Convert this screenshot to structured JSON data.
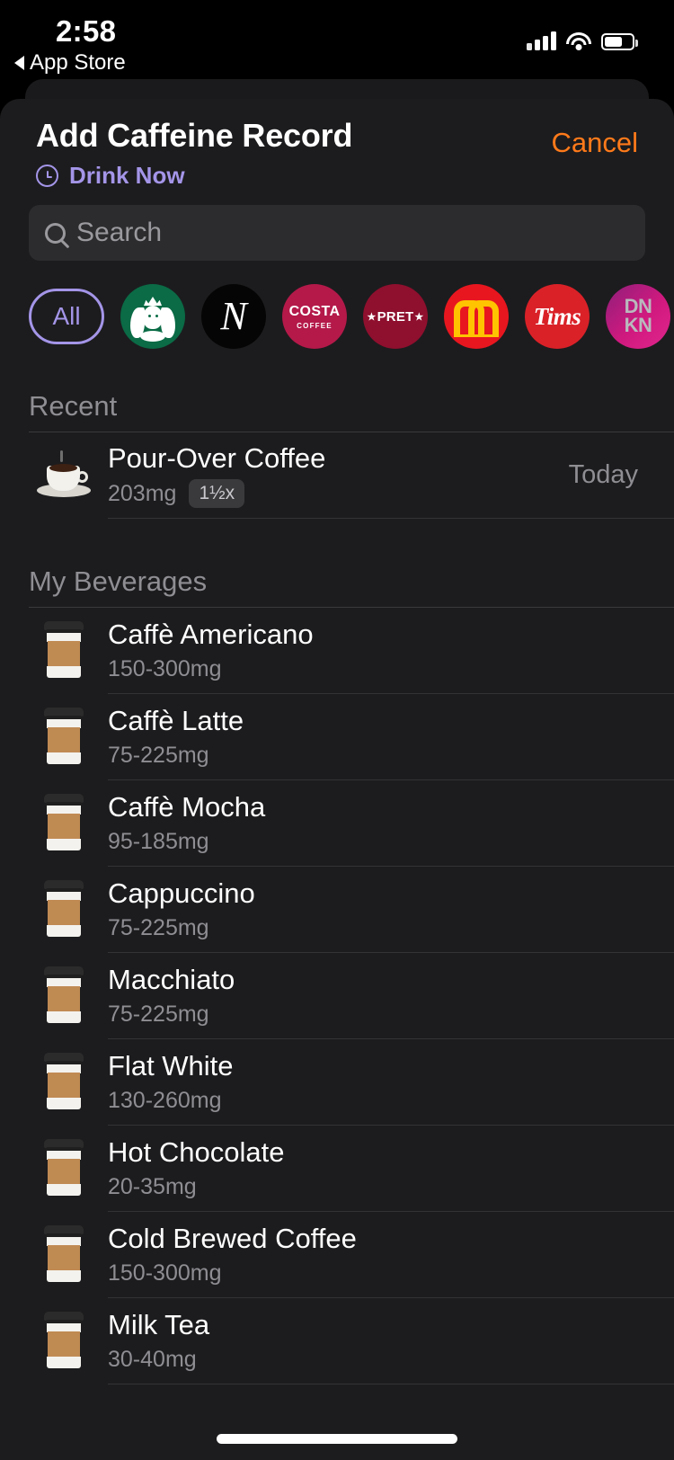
{
  "status_bar": {
    "time": "2:58",
    "back_label": "App Store",
    "icons": [
      "signal-bars-icon",
      "wifi-icon",
      "battery-icon"
    ]
  },
  "sheet": {
    "title": "Add Caffeine Record",
    "cancel_label": "Cancel",
    "drink_now_label": "Drink Now",
    "drink_now_icon": "clock-icon",
    "accent_purple": "#a495e8",
    "accent_orange": "#ff7a1a"
  },
  "search": {
    "placeholder": "Search",
    "value": "",
    "icon": "search-icon"
  },
  "brands": [
    {
      "id": "all",
      "label": "All",
      "selected": true,
      "color": "#a495e8"
    },
    {
      "id": "starbucks",
      "label": "Starbucks",
      "selected": false,
      "color": "#0a6b46"
    },
    {
      "id": "nespresso",
      "label": "Nespresso",
      "selected": false,
      "color": "#050505"
    },
    {
      "id": "costa",
      "label": "Costa Coffee",
      "selected": false,
      "color": "#b4194a"
    },
    {
      "id": "pret",
      "label": "Pret",
      "selected": false,
      "color": "#8f0f2e"
    },
    {
      "id": "mcdonalds",
      "label": "McDonald's",
      "selected": false,
      "color": "#e8161f"
    },
    {
      "id": "tims",
      "label": "Tims",
      "selected": false,
      "color": "#da2128"
    },
    {
      "id": "dunkin",
      "label": "Dunkin'",
      "selected": false,
      "color": "#c4187e"
    }
  ],
  "brand_text": {
    "costa_line1": "COSTA",
    "costa_line2": "COFFEE",
    "pret": "PRET",
    "tims": "Tims",
    "dunkin_line1": "DN",
    "dunkin_line2": "KN",
    "nespresso": "N"
  },
  "recent": {
    "header": "Recent",
    "items": [
      {
        "name": "Pour-Over Coffee",
        "amount": "203mg",
        "multiplier": "1½x",
        "when": "Today",
        "icon": "coffee-cup-saucer-icon"
      }
    ]
  },
  "my_beverages": {
    "header": "My Beverages",
    "items": [
      {
        "name": "Caffè Americano",
        "range": "150-300mg",
        "icon": "togo-cup-icon"
      },
      {
        "name": "Caffè Latte",
        "range": "75-225mg",
        "icon": "togo-cup-icon"
      },
      {
        "name": "Caffè Mocha",
        "range": "95-185mg",
        "icon": "togo-cup-icon"
      },
      {
        "name": "Cappuccino",
        "range": "75-225mg",
        "icon": "togo-cup-icon"
      },
      {
        "name": "Macchiato",
        "range": "75-225mg",
        "icon": "togo-cup-icon"
      },
      {
        "name": "Flat White",
        "range": "130-260mg",
        "icon": "togo-cup-icon"
      },
      {
        "name": "Hot Chocolate",
        "range": "20-35mg",
        "icon": "togo-cup-icon"
      },
      {
        "name": "Cold Brewed Coffee",
        "range": "150-300mg",
        "icon": "togo-cup-icon"
      },
      {
        "name": "Milk Tea",
        "range": "30-40mg",
        "icon": "togo-cup-icon"
      }
    ]
  }
}
